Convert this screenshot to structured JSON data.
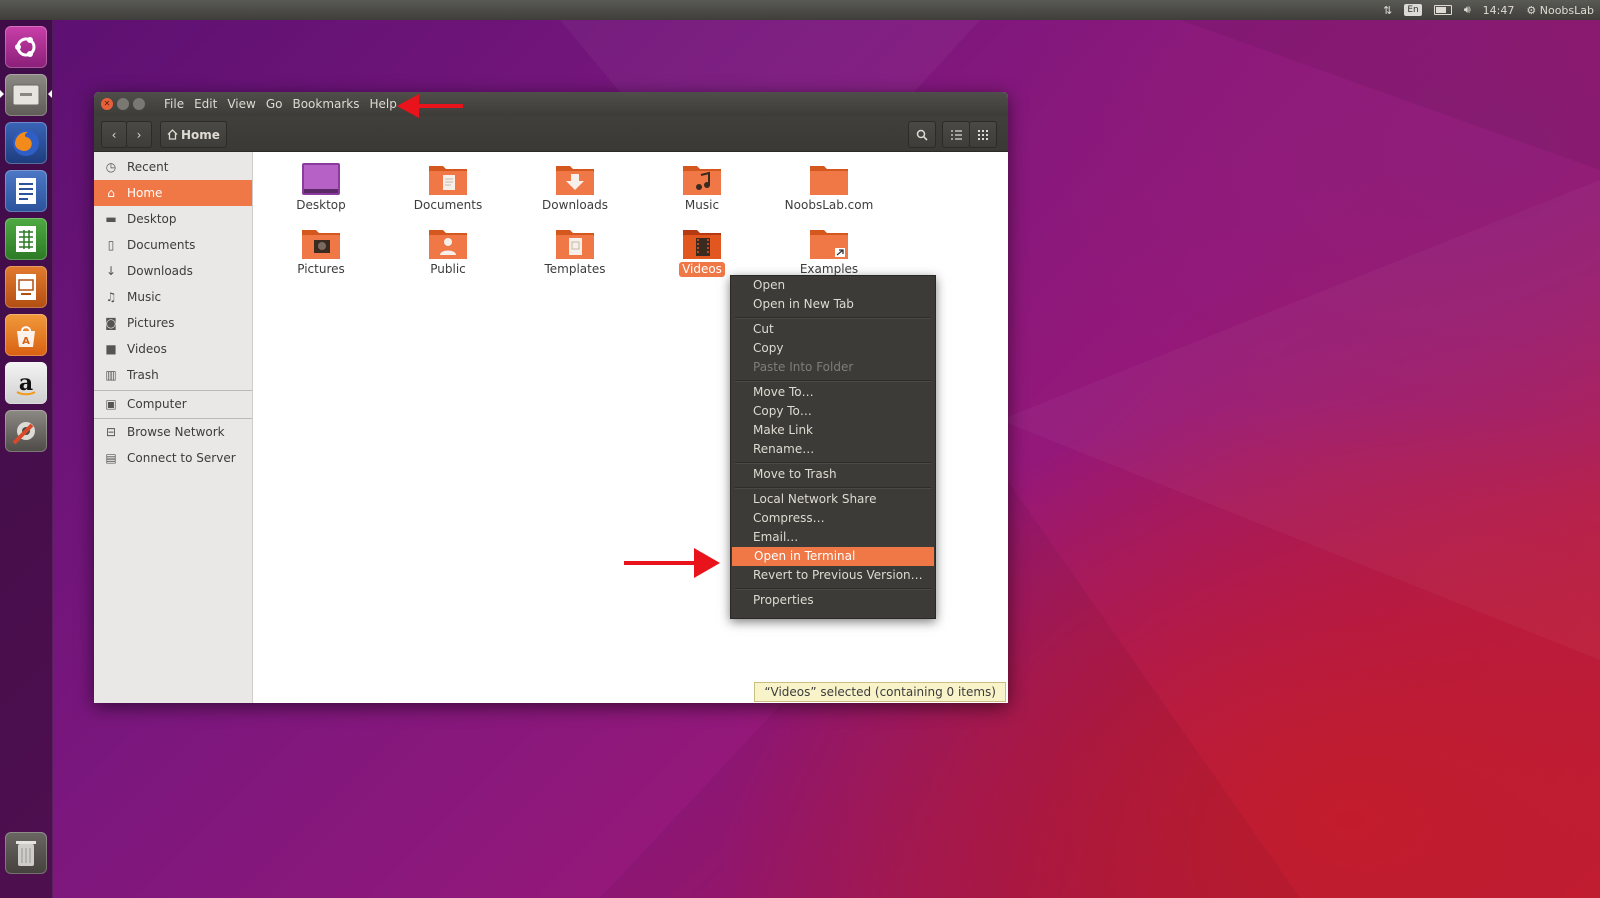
{
  "top_panel": {
    "keyboard_layout": "En",
    "clock": "14:47",
    "user": "NoobsLab"
  },
  "launcher": {
    "items": [
      "ubuntu-dash",
      "files",
      "firefox",
      "libreoffice-writer",
      "libreoffice-calc",
      "libreoffice-impress",
      "ubuntu-software-center",
      "amazon",
      "system-settings",
      "trash"
    ]
  },
  "window": {
    "menu": [
      "File",
      "Edit",
      "View",
      "Go",
      "Bookmarks",
      "Help"
    ],
    "path_button": "Home"
  },
  "sidebar": {
    "items": [
      {
        "label": "Recent",
        "icon": "clock-icon"
      },
      {
        "label": "Home",
        "icon": "home-icon",
        "active": true
      },
      {
        "label": "Desktop",
        "icon": "folder-icon"
      },
      {
        "label": "Documents",
        "icon": "document-icon"
      },
      {
        "label": "Downloads",
        "icon": "download-icon"
      },
      {
        "label": "Music",
        "icon": "music-icon"
      },
      {
        "label": "Pictures",
        "icon": "camera-icon"
      },
      {
        "label": "Videos",
        "icon": "video-icon"
      },
      {
        "label": "Trash",
        "icon": "trash-icon"
      },
      {
        "label": "Computer",
        "icon": "computer-icon"
      },
      {
        "label": "Browse Network",
        "icon": "network-icon"
      },
      {
        "label": "Connect to Server",
        "icon": "server-icon"
      }
    ]
  },
  "files": [
    {
      "name": "Desktop",
      "icon": "desktop-folder"
    },
    {
      "name": "Documents",
      "icon": "documents-folder"
    },
    {
      "name": "Downloads",
      "icon": "downloads-folder"
    },
    {
      "name": "Music",
      "icon": "music-folder"
    },
    {
      "name": "NoobsLab.com",
      "icon": "folder"
    },
    {
      "name": "Pictures",
      "icon": "pictures-folder"
    },
    {
      "name": "Public",
      "icon": "public-folder"
    },
    {
      "name": "Templates",
      "icon": "templates-folder"
    },
    {
      "name": "Videos",
      "icon": "videos-folder",
      "selected": true
    },
    {
      "name": "Examples",
      "icon": "link-folder"
    }
  ],
  "status_bar": "“Videos” selected  (containing 0 items)",
  "context_menu": {
    "items": [
      {
        "label": "Open"
      },
      {
        "label": "Open in New Tab"
      },
      {
        "label": "Cut"
      },
      {
        "label": "Copy"
      },
      {
        "label": "Paste Into Folder",
        "disabled": true
      },
      {
        "label": "Move To…"
      },
      {
        "label": "Copy To…"
      },
      {
        "label": "Make Link"
      },
      {
        "label": "Rename…"
      },
      {
        "label": "Move to Trash"
      },
      {
        "label": "Local Network Share"
      },
      {
        "label": "Compress…"
      },
      {
        "label": "Email…"
      },
      {
        "label": "Open in Terminal",
        "highlighted": true
      },
      {
        "label": "Revert to Previous Version…"
      },
      {
        "label": "Properties"
      }
    ]
  },
  "colors": {
    "accent": "#f07746",
    "annotation_arrow": "#e8131b",
    "panel": "#3c3b37"
  }
}
